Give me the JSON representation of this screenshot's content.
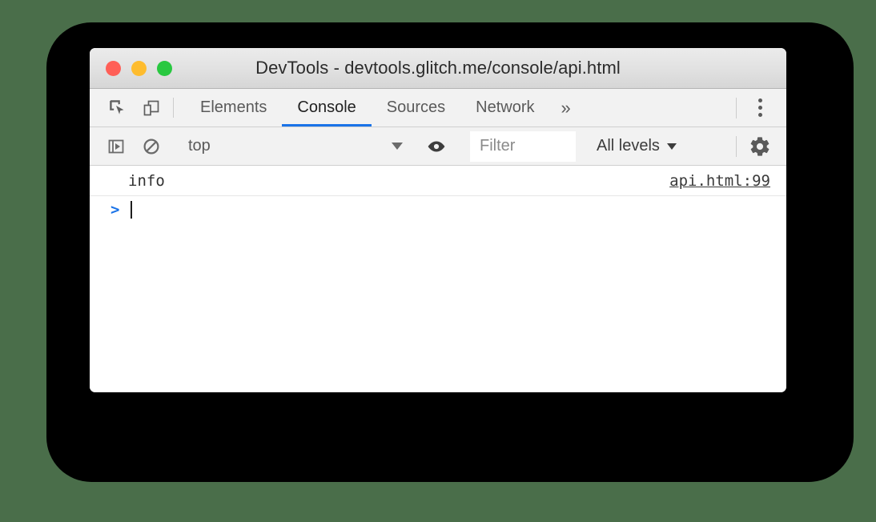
{
  "window": {
    "title": "DevTools - devtools.glitch.me/console/api.html",
    "traffic_lights": [
      {
        "name": "close",
        "color": "#ff5f57"
      },
      {
        "name": "minimize",
        "color": "#febc2e"
      },
      {
        "name": "zoom",
        "color": "#28c840"
      }
    ]
  },
  "tabbar": {
    "inspect_icon": "inspect-element-icon",
    "device_icon": "device-toolbar-icon",
    "tabs": [
      {
        "label": "Elements",
        "active": false
      },
      {
        "label": "Console",
        "active": true
      },
      {
        "label": "Sources",
        "active": false
      },
      {
        "label": "Network",
        "active": false
      }
    ],
    "more_tabs_label": "»",
    "menu_icon": "kebab-menu-icon",
    "active_underline_color": "#1a73e8"
  },
  "filterbar": {
    "sidebar_toggle_icon": "console-sidebar-icon",
    "clear_icon": "clear-console-icon",
    "context": {
      "value": "top",
      "caret": "▼"
    },
    "eye_icon": "live-expression-eye-icon",
    "filter": {
      "placeholder": "Filter",
      "value": ""
    },
    "levels": {
      "value": "All levels",
      "caret": "▼"
    },
    "settings_icon": "settings-gear-icon"
  },
  "console": {
    "messages": [
      {
        "text": "info",
        "source": "api.html:99"
      }
    ],
    "prompt": {
      "arrow": ">",
      "input_value": ""
    }
  },
  "colors": {
    "page_background": "#4a6e4a",
    "backdrop": "#000000",
    "window_background": "#ffffff",
    "accent_blue": "#1a73e8"
  }
}
